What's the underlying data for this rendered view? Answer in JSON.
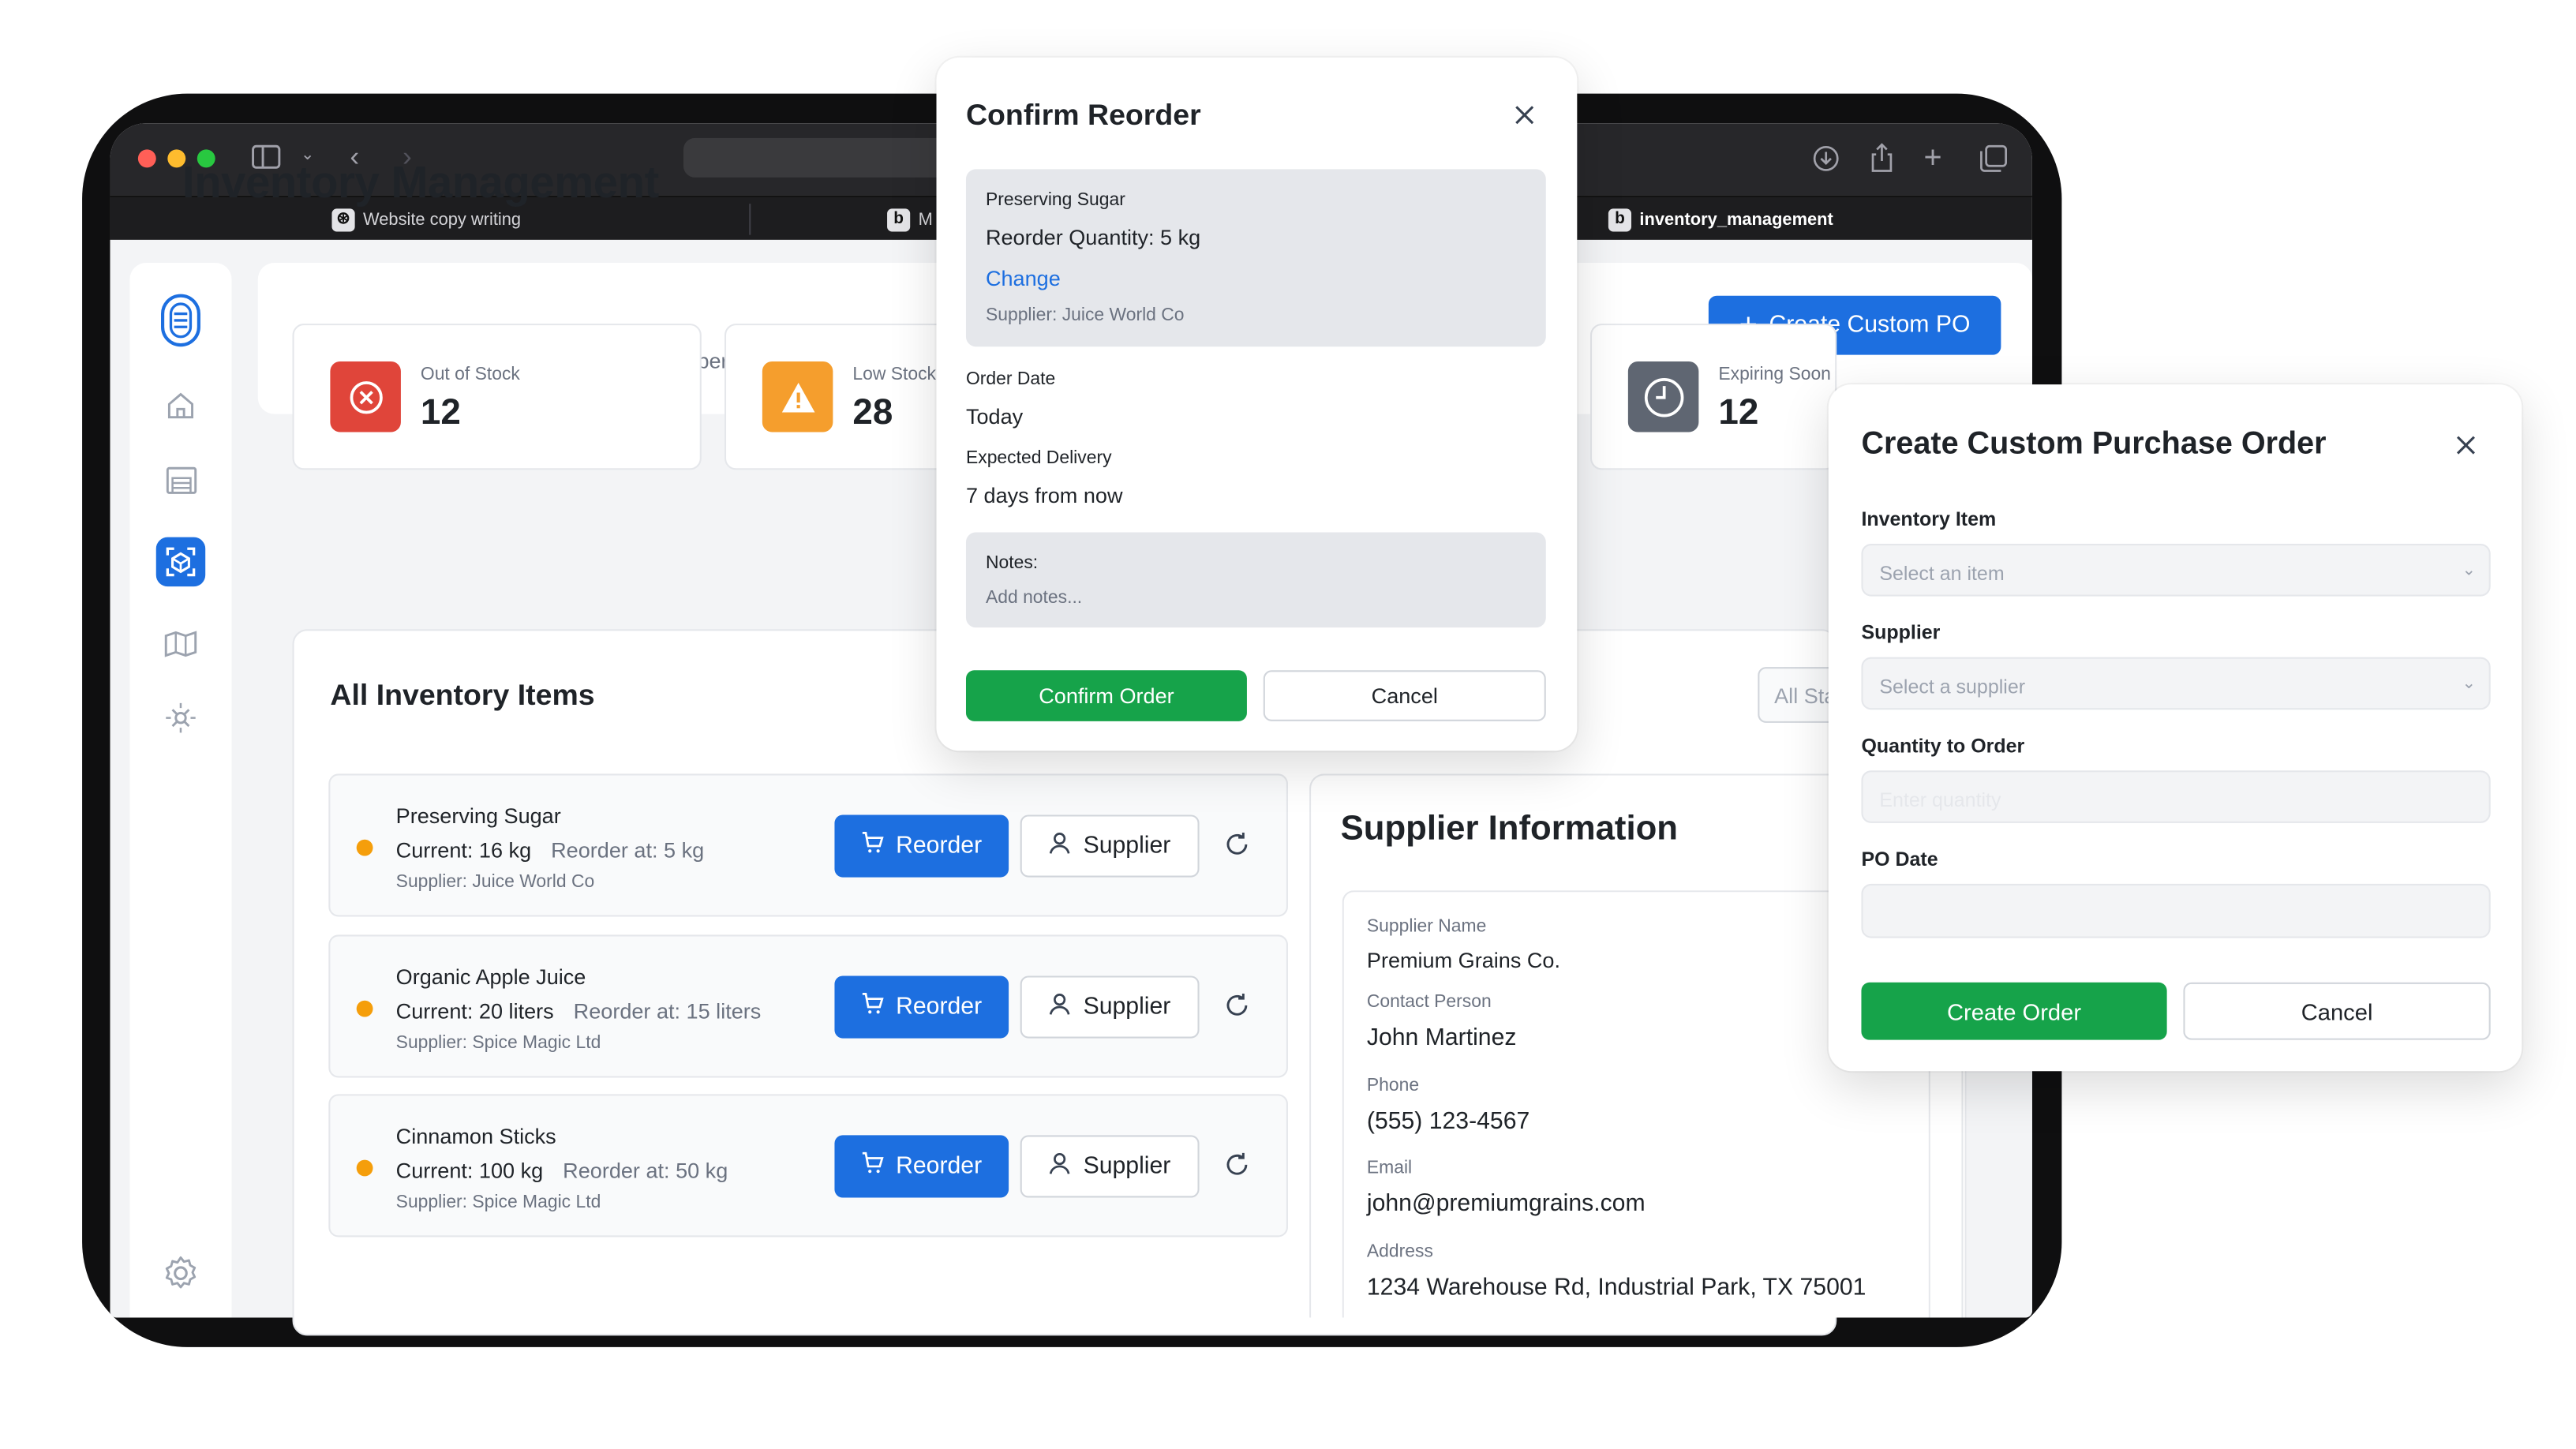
{
  "browser": {
    "tabs": [
      {
        "title": "Website copy writing"
      },
      {
        "title": "M"
      },
      {
        "title": "inventory_management"
      }
    ]
  },
  "header": {
    "title": "Inventory Management",
    "subtitle": "Monitor stock levels and manage reorder operations",
    "create_po_label": "Create Custom PO"
  },
  "stats": [
    {
      "label": "Out of Stock",
      "value": "12",
      "color": "#e0453a",
      "icon": "x-circle-icon"
    },
    {
      "label": "Low Stock",
      "value": "28",
      "color": "#f59e2d",
      "icon": "warning-icon"
    },
    {
      "label": "Expiring Soon",
      "value": "12",
      "color": "#5f6672",
      "icon": "clock-icon"
    }
  ],
  "inventory": {
    "title": "All Inventory Items",
    "filter_value": "All Status",
    "reorder_label": "Reorder",
    "supplier_label": "Supplier",
    "items": [
      {
        "name": "Preserving Sugar",
        "current": "Current: 16 kg",
        "reorder_at": "Reorder at: 5 kg",
        "supplier": "Supplier: Juice World Co"
      },
      {
        "name": "Organic Apple Juice",
        "current": "Current: 20 liters",
        "reorder_at": "Reorder at: 15 liters",
        "supplier": "Supplier: Spice Magic Ltd"
      },
      {
        "name": "Cinnamon Sticks",
        "current": "Current: 100 kg",
        "reorder_at": "Reorder at: 50 kg",
        "supplier": "Supplier: Spice Magic Ltd"
      }
    ]
  },
  "supplier_info": {
    "title": "Supplier Information",
    "name_label": "Supplier Name",
    "name": "Premium Grains Co.",
    "contact_label": "Contact Person",
    "contact": "John Martinez",
    "phone_label": "Phone",
    "phone": "(555) 123-4567",
    "email_label": "Email",
    "email": "john@premiumgrains.com",
    "address_label": "Address",
    "address": "1234 Warehouse Rd, Industrial Park, TX 75001"
  },
  "confirm_modal": {
    "title": "Confirm Reorder",
    "item_name": "Preserving Sugar",
    "reorder_qty": "Reorder Quantity: 5 kg",
    "change_label": "Change",
    "supplier": "Supplier: Juice World Co",
    "order_date_label": "Order Date",
    "order_date": "Today",
    "delivery_label": "Expected Delivery",
    "delivery": "7 days from now",
    "notes_label": "Notes:",
    "notes_placeholder": "Add notes...",
    "confirm_label": "Confirm Order",
    "cancel_label": "Cancel"
  },
  "po_modal": {
    "title": "Create Custom Purchase Order",
    "item_label": "Inventory Item",
    "item_placeholder": "Select an item",
    "supplier_label": "Supplier",
    "supplier_placeholder": "Select a supplier",
    "qty_label": "Quantity to Order",
    "qty_placeholder": "Enter quantity",
    "date_label": "PO Date",
    "date_value": "",
    "create_label": "Create Order",
    "cancel_label": "Cancel"
  },
  "colors": {
    "primary": "#1d6fe0",
    "success": "#16a34a",
    "warning_dot": "#f59e0b"
  }
}
